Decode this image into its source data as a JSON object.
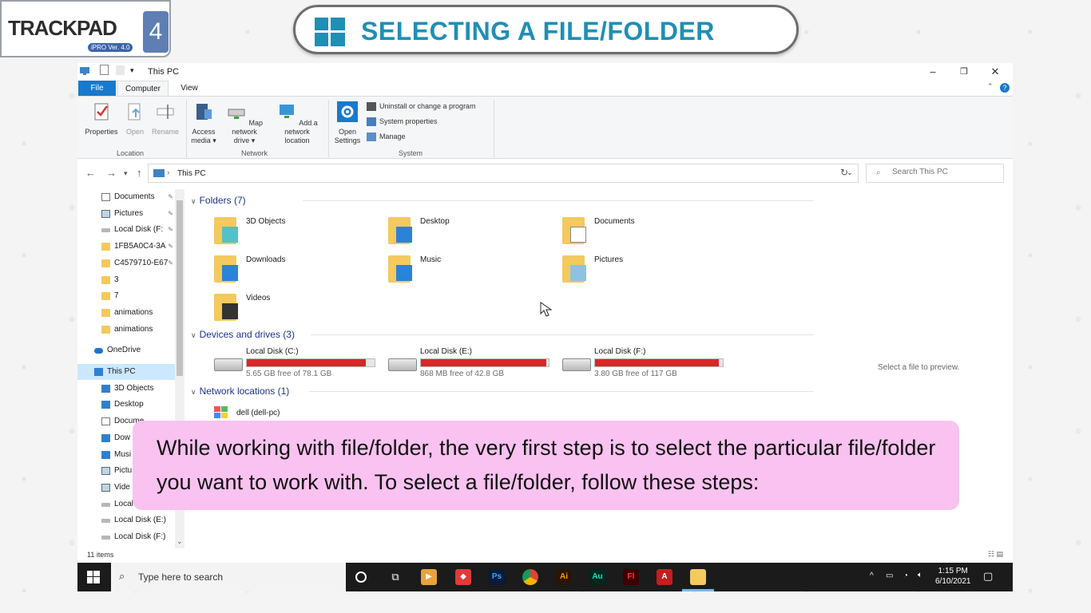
{
  "logo": {
    "word": "TRACKPAD",
    "num": "4",
    "ver": "iPRO Ver. 4.0"
  },
  "banner": {
    "title": "SELECTING A FILE/FOLDER"
  },
  "window": {
    "title": "This PC",
    "tabs": [
      "File",
      "Computer",
      "View"
    ]
  },
  "ribbon": {
    "location": {
      "label": "Location",
      "properties": "Properties",
      "open": "Open",
      "rename": "Rename"
    },
    "network": {
      "label": "Network",
      "access_media": [
        "Access",
        "media ▾"
      ],
      "map_drive": [
        "Map network",
        "drive ▾"
      ],
      "add_location": [
        "Add a network",
        "location"
      ]
    },
    "system": {
      "label": "System",
      "open_settings": [
        "Open",
        "Settings"
      ],
      "uninstall": "Uninstall or change a program",
      "system_properties": "System properties",
      "manage": "Manage"
    }
  },
  "address": {
    "crumb": "This PC",
    "search_placeholder": "Search This PC"
  },
  "nav": {
    "quick": [
      {
        "label": "Documents",
        "icon": "doc",
        "pin": true
      },
      {
        "label": "Pictures",
        "icon": "pic",
        "pin": true
      },
      {
        "label": "Local Disk (F:",
        "icon": "disk",
        "pin": true
      },
      {
        "label": "1FB5A0C4-3A",
        "icon": "folder",
        "pin": true
      },
      {
        "label": "C4579710-E67",
        "icon": "folder",
        "pin": true
      },
      {
        "label": "3",
        "icon": "folder",
        "pin": false
      },
      {
        "label": "7",
        "icon": "folder",
        "pin": false
      },
      {
        "label": "animations",
        "icon": "folder",
        "pin": false
      },
      {
        "label": "animations",
        "icon": "folder",
        "pin": false
      }
    ],
    "onedrive": "OneDrive",
    "thispc": "This PC",
    "pc_items": [
      {
        "label": "3D Objects",
        "icon": "blue"
      },
      {
        "label": "Desktop",
        "icon": "blue"
      },
      {
        "label": "Docume",
        "icon": "doc"
      },
      {
        "label": "Dow",
        "icon": "blue"
      },
      {
        "label": "Musi",
        "icon": "blue"
      },
      {
        "label": "Pictu",
        "icon": "pic"
      },
      {
        "label": "Vide",
        "icon": "pic"
      },
      {
        "label": "Local",
        "icon": "disk"
      },
      {
        "label": "Local Disk (E:)",
        "icon": "disk"
      },
      {
        "label": "Local Disk (F:)",
        "icon": "disk"
      }
    ]
  },
  "content": {
    "folders_header": "Folders (7)",
    "folders": [
      "3D Objects",
      "Desktop",
      "Documents",
      "Downloads",
      "Music",
      "Pictures",
      "Videos"
    ],
    "drives_header": "Devices and drives (3)",
    "drives": [
      {
        "name": "Local Disk (C:)",
        "free": "5.65 GB free of 78.1 GB",
        "used": 0.93
      },
      {
        "name": "Local Disk (E:)",
        "free": "868 MB free of 42.8 GB",
        "used": 0.98
      },
      {
        "name": "Local Disk (F:)",
        "free": "3.80 GB free of 117 GB",
        "used": 0.97
      }
    ],
    "network_header": "Network locations (1)",
    "network_item": "dell (dell-pc)",
    "preview": "Select a file to preview.",
    "status": "11 items"
  },
  "caption": "While working with file/folder, the very first step is to select the particular file/folder you want to work with. To select a file/folder, follow these steps:",
  "taskbar": {
    "search": "Type here to search",
    "apps": [
      "Ps",
      "Ai",
      "Au",
      "Fl"
    ],
    "time": "1:15 PM",
    "date": "6/10/2021"
  },
  "colors": {
    "accent": "#1979ca",
    "drive_bar": "#da2626",
    "caption_bg": "#f9c2f0",
    "banner_text": "#1f8fb4"
  }
}
